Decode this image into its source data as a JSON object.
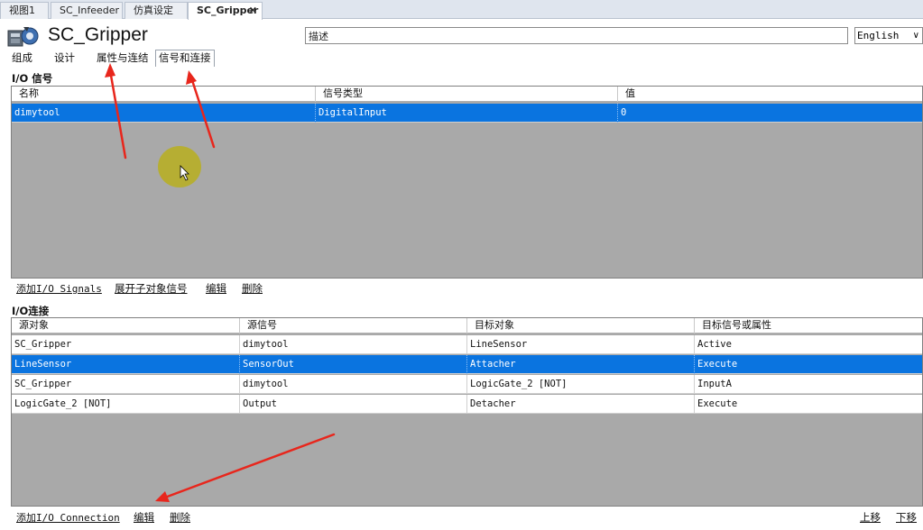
{
  "doc_tabs": [
    {
      "label": "视图1"
    },
    {
      "label": "SC_Infeeder"
    },
    {
      "label": "仿真设定"
    },
    {
      "label": "SC_Gripper",
      "close": "✕"
    }
  ],
  "header": {
    "icon": "smart-component-icon",
    "title": "SC_Gripper",
    "description_value": "描述",
    "language": "English",
    "language_chevron": "∨"
  },
  "sub_tabs": [
    "组成",
    "设计",
    "属性与连结",
    "信号和连接"
  ],
  "io_signals": {
    "title": "I/O 信号",
    "columns": [
      "名称",
      "信号类型",
      "值"
    ],
    "rows": [
      {
        "name": "dimytool",
        "type": "DigitalInput",
        "value": "0",
        "selected": true
      }
    ],
    "actions": [
      "添加I/O Signals",
      "展开子对象信号",
      "编辑",
      "删除"
    ]
  },
  "io_connections": {
    "title": "I/O连接",
    "columns": [
      "源对象",
      "源信号",
      "目标对象",
      "目标信号或属性"
    ],
    "rows": [
      {
        "source": "SC_Gripper",
        "signal": "dimytool",
        "target": "LineSensor",
        "target_signal": "Active"
      },
      {
        "source": "LineSensor",
        "signal": "SensorOut",
        "target": "Attacher",
        "target_signal": "Execute",
        "selected": true
      },
      {
        "source": "SC_Gripper",
        "signal": "dimytool",
        "target": "LogicGate_2 [NOT]",
        "target_signal": "InputA"
      },
      {
        "source": "LogicGate_2 [NOT]",
        "signal": "Output",
        "target": "Detacher",
        "target_signal": "Execute"
      }
    ],
    "actions": [
      "添加I/O Connection",
      "编辑",
      "删除"
    ],
    "order_actions": [
      "上移",
      "下移"
    ]
  },
  "colors": {
    "selection": "#0a74e0",
    "grid_background": "#a9a9a9",
    "annotation_arrow": "#e8261c",
    "cursor_highlight": "#b9af1e"
  }
}
